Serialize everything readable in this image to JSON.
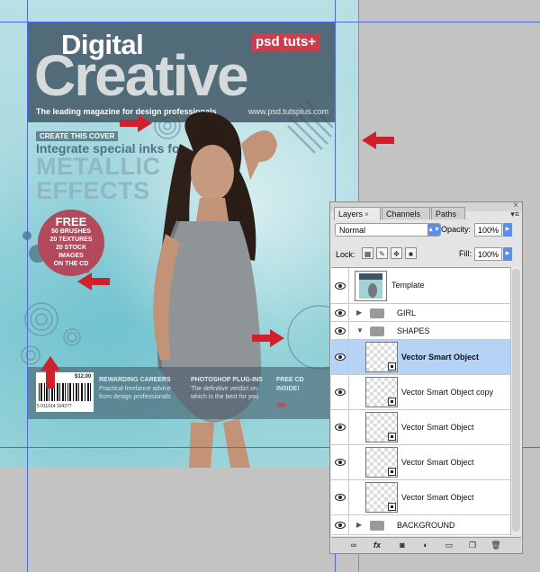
{
  "cover": {
    "digital": "Digital",
    "creative": "Creative",
    "psd_badge": "psd tuts+",
    "tagline": "The leading magazine for design professionals",
    "site": "www.psd.tutsplus.com",
    "create_badge": "CREATE THIS COVER",
    "integrate": "Integrate special inks for",
    "metallic": "METALLIC",
    "effects": "EFFECTS",
    "free": {
      "title": "FREE",
      "lines": [
        "50 BRUSHES",
        "20 TEXTURES",
        "20 STOCK",
        "IMAGES",
        "ON THE CD"
      ]
    },
    "price": "$12.00",
    "barcode_number": "5 011914 104277",
    "strip": [
      {
        "heading": "REWARDING CAREERS",
        "text1": "Practical freelance advice",
        "text2": "from design professionals"
      },
      {
        "heading": "PHOTOSHOP PLUG-INS",
        "text1": "The definitive verdict on",
        "text2": "which is the best for you"
      },
      {
        "heading": "FREE CD",
        "text1": "INSIDE!",
        "text2": ""
      }
    ],
    "chevrons": "»»"
  },
  "panel": {
    "tabs": [
      {
        "label": "Layers",
        "close": "×"
      },
      {
        "label": "Channels"
      },
      {
        "label": "Paths"
      }
    ],
    "close_icon": "×",
    "menu_icon": "▾≡",
    "blend_mode": "Normal",
    "opacity_label": "Opacity:",
    "opacity_value": "100%",
    "lock_label": "Lock:",
    "fill_label": "Fill:",
    "fill_value": "100%",
    "layers": [
      {
        "name": "Template",
        "kind": "image"
      },
      {
        "name": "GIRL",
        "kind": "group-collapsed"
      },
      {
        "name": "SHAPES",
        "kind": "group-expanded"
      },
      {
        "name": "Vector Smart Object",
        "kind": "smart",
        "selected": true
      },
      {
        "name": "Vector Smart Object copy",
        "kind": "smart"
      },
      {
        "name": "Vector Smart Object",
        "kind": "smart"
      },
      {
        "name": "Vector Smart Object",
        "kind": "smart"
      },
      {
        "name": "Vector Smart Object",
        "kind": "smart"
      },
      {
        "name": "BACKGROUND",
        "kind": "group-collapsed"
      }
    ],
    "bottom_icons": [
      "link-icon",
      "fx-icon",
      "mask-icon",
      "adjustment-icon",
      "folder-icon",
      "new-layer-icon",
      "trash-icon"
    ],
    "fx_label": "fx"
  },
  "colors": {
    "guide": "#4d68e8",
    "arrow": "#d0202e",
    "selection": "#b6d2f4",
    "accent_blue": "#5a8ee8"
  }
}
